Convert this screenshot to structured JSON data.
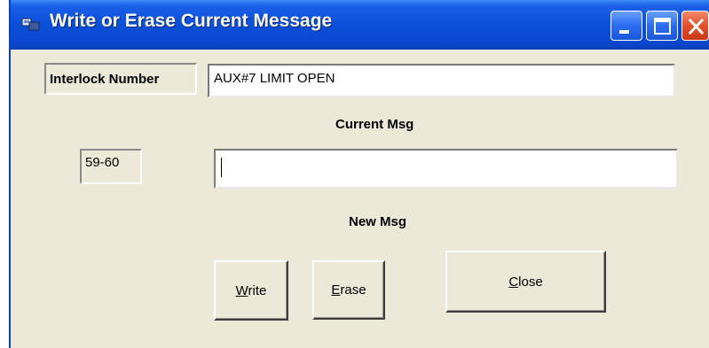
{
  "window": {
    "title": "Write or Erase Current Message",
    "controls": {
      "minimize": "minimize-icon",
      "maximize": "maximize-icon",
      "close": "close-icon"
    }
  },
  "interlock": {
    "label": "Interlock Number",
    "current_message_value": "AUX#7 LIMIT OPEN"
  },
  "captions": {
    "current_msg": "Current Msg",
    "new_msg": "New Msg"
  },
  "message_number": "59-60",
  "new_message_value": "",
  "buttons": {
    "write": {
      "mnemonic": "W",
      "rest": "rite"
    },
    "erase": {
      "mnemonic": "E",
      "rest": "rase"
    },
    "close": {
      "mnemonic": "C",
      "rest": "lose"
    }
  },
  "colors": {
    "titlebar": "#0b4fd8",
    "window_bg": "#ece9d8",
    "close_button": "#e0502b"
  }
}
